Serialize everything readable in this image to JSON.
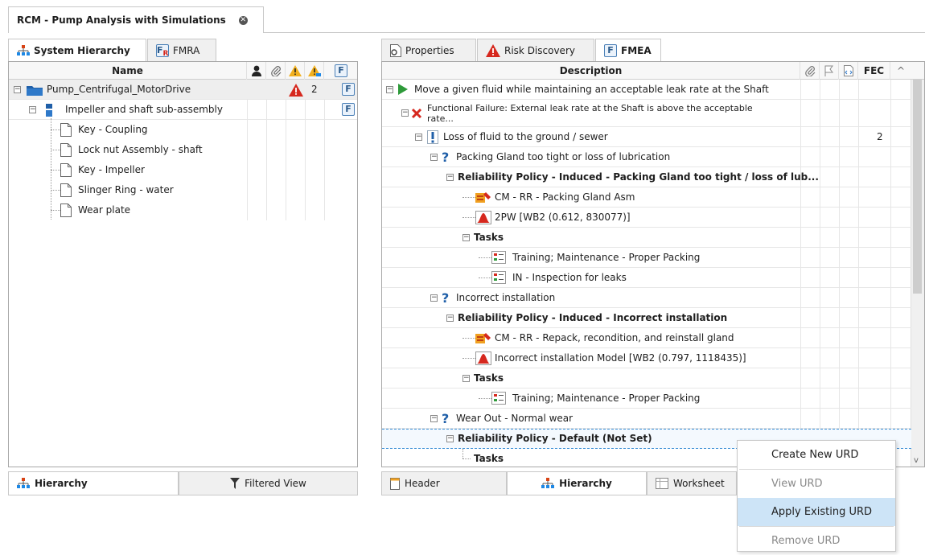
{
  "document_tab": {
    "title": "RCM - Pump Analysis with Simulations"
  },
  "left_panel": {
    "tabs": [
      {
        "label": "System Hierarchy",
        "icon": "hierarchy-icon",
        "active": true
      },
      {
        "label": "FMRA",
        "icon": "fmra-icon",
        "active": false
      }
    ],
    "columns": {
      "name": "Name"
    },
    "rows": [
      {
        "label": "Pump_Centrifugal_MotorDrive",
        "icon": "folder-icon",
        "risk": "2"
      },
      {
        "label": "Impeller and shaft sub-assembly",
        "icon": "assembly-icon"
      },
      {
        "label": "Key - Coupling",
        "icon": "document-icon"
      },
      {
        "label": "Lock nut Assembly - shaft",
        "icon": "document-icon"
      },
      {
        "label": "Key - Impeller",
        "icon": "document-icon"
      },
      {
        "label": "Slinger Ring - water",
        "icon": "document-icon"
      },
      {
        "label": "Wear plate",
        "icon": "document-icon"
      }
    ],
    "bottom_tabs": [
      {
        "label": "Hierarchy",
        "icon": "hierarchy-icon",
        "active": true
      },
      {
        "label": "Filtered View",
        "icon": "filter-icon",
        "active": false
      }
    ]
  },
  "right_panel": {
    "tabs": [
      {
        "label": "Properties",
        "icon": "properties-icon",
        "active": false
      },
      {
        "label": "Risk Discovery",
        "icon": "warning-icon",
        "active": false
      },
      {
        "label": "FMEA",
        "icon": "fmea-icon",
        "active": true
      }
    ],
    "columns": {
      "description": "Description",
      "fec": "FEC"
    },
    "rows": [
      {
        "label": "Move a given fluid while maintaining an acceptable leak rate at the Shaft",
        "icon": "play-icon"
      },
      {
        "label": "Functional Failure: External leak rate at the Shaft is above the acceptable",
        "label2": "rate...",
        "icon": "failure-x-icon"
      },
      {
        "label": "Loss of fluid to the ground / sewer",
        "icon": "effect-exclamation-icon",
        "fec": "2"
      },
      {
        "label": "Packing Gland too tight or loss of lubrication",
        "icon": "cause-question-icon"
      },
      {
        "label": "Reliability Policy - Induced - Packing Gland too tight / loss of lub...",
        "bold": true
      },
      {
        "label": "CM - RR - Packing Gland Asm",
        "icon": "repair-icon"
      },
      {
        "label": "2PW [WB2 (0.612, 830077)]",
        "icon": "distribution-icon"
      },
      {
        "label": "Tasks",
        "bold": true
      },
      {
        "label": "Training; Maintenance - Proper Packing",
        "icon": "task-icon"
      },
      {
        "label": "IN - Inspection for leaks",
        "icon": "task-icon"
      },
      {
        "label": "Incorrect installation",
        "icon": "cause-question-icon"
      },
      {
        "label": "Reliability Policy - Induced - Incorrect installation",
        "bold": true
      },
      {
        "label": "CM - RR - Repack, recondition, and reinstall gland",
        "icon": "repair-icon"
      },
      {
        "label": "Incorrect installation Model [WB2 (0.797, 1118435)]",
        "icon": "distribution-icon"
      },
      {
        "label": "Tasks",
        "bold": true
      },
      {
        "label": "Training; Maintenance - Proper Packing",
        "icon": "task-icon"
      },
      {
        "label": "Wear Out - Normal wear",
        "icon": "cause-question-icon"
      },
      {
        "label": "Reliability Policy - Default (Not Set)",
        "bold": true,
        "selected": true
      },
      {
        "label": "Tasks",
        "bold": true
      }
    ],
    "bottom_tabs": [
      {
        "label": "Header",
        "icon": "header-icon",
        "active": false
      },
      {
        "label": "Hierarchy",
        "icon": "hierarchy-icon",
        "active": true
      },
      {
        "label": "Worksheet",
        "icon": "worksheet-icon",
        "active": false
      }
    ]
  },
  "context_menu": {
    "items": [
      {
        "label": "Create New URD",
        "enabled": true
      },
      {
        "label": "View URD",
        "enabled": false
      },
      {
        "label": "Apply Existing URD",
        "enabled": true,
        "hover": true
      },
      {
        "label": "Remove URD",
        "enabled": false
      }
    ]
  },
  "colors": {
    "accent": "#4a7fb6",
    "warning": "#d6281e",
    "selection": "#cde4f7"
  }
}
